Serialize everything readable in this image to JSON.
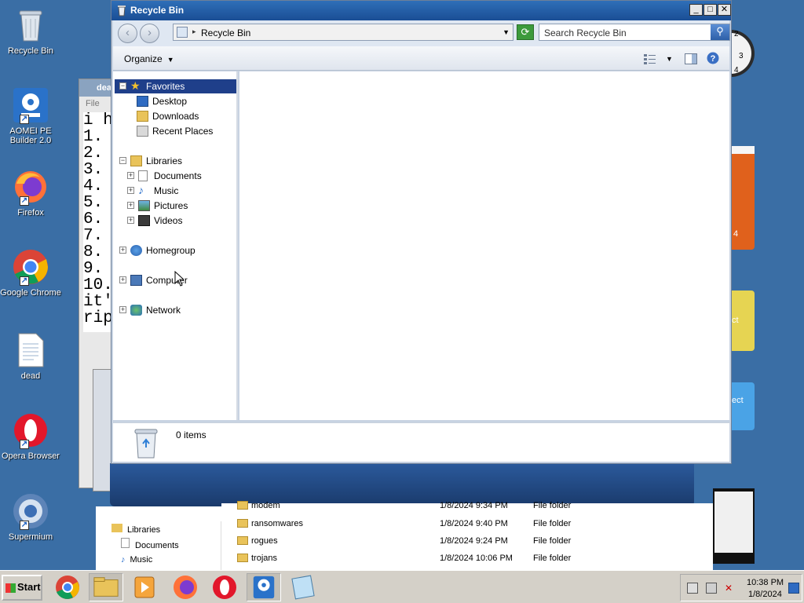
{
  "desktop": {
    "icons": [
      {
        "label": "Recycle Bin"
      },
      {
        "label": "AOMEI PE Builder 2.0"
      },
      {
        "label": "Firefox"
      },
      {
        "label": "Google Chrome"
      },
      {
        "label": "dead"
      },
      {
        "label": "Opera Browser"
      },
      {
        "label": "Supermium"
      }
    ],
    "gadget_calendar_text": "4",
    "gadget_sticky_text": "ct",
    "gadget_blue_text": "ect"
  },
  "notepad": {
    "title": "dea",
    "menu_file": "File",
    "text": "i h\n1.\n2.\n3.\n4.\n5.\n6.\n7.\n8.\n9.\n10.\nit'\nrip"
  },
  "window": {
    "title": "Recycle Bin",
    "address": "Recycle Bin",
    "search_placeholder": "Search Recycle Bin",
    "organize_label": "Organize",
    "status_count": "0 items"
  },
  "navpane": {
    "favorites": {
      "label": "Favorites",
      "children": [
        "Desktop",
        "Downloads",
        "Recent Places"
      ]
    },
    "libraries": {
      "label": "Libraries",
      "children": [
        "Documents",
        "Music",
        "Pictures",
        "Videos"
      ]
    },
    "homegroup": "Homegroup",
    "computer": "Computer",
    "network": "Network"
  },
  "bg_explorer": {
    "left_items": [
      "Libraries",
      "Documents",
      "Music"
    ],
    "files": [
      {
        "name": "modem",
        "date": "1/8/2024 9:34 PM",
        "type": "File folder"
      },
      {
        "name": "ransomwares",
        "date": "1/8/2024 9:40 PM",
        "type": "File folder"
      },
      {
        "name": "rogues",
        "date": "1/8/2024 9:24 PM",
        "type": "File folder"
      },
      {
        "name": "trojans",
        "date": "1/8/2024 10:06 PM",
        "type": "File folder"
      }
    ]
  },
  "taskbar": {
    "start_label": "Start",
    "clock_time": "10:38 PM",
    "clock_date": "1/8/2024"
  },
  "colors": {
    "desktop_bg": "#3a6ea5",
    "selection": "#1f3f8a",
    "titlebar": "#1a4e95"
  }
}
